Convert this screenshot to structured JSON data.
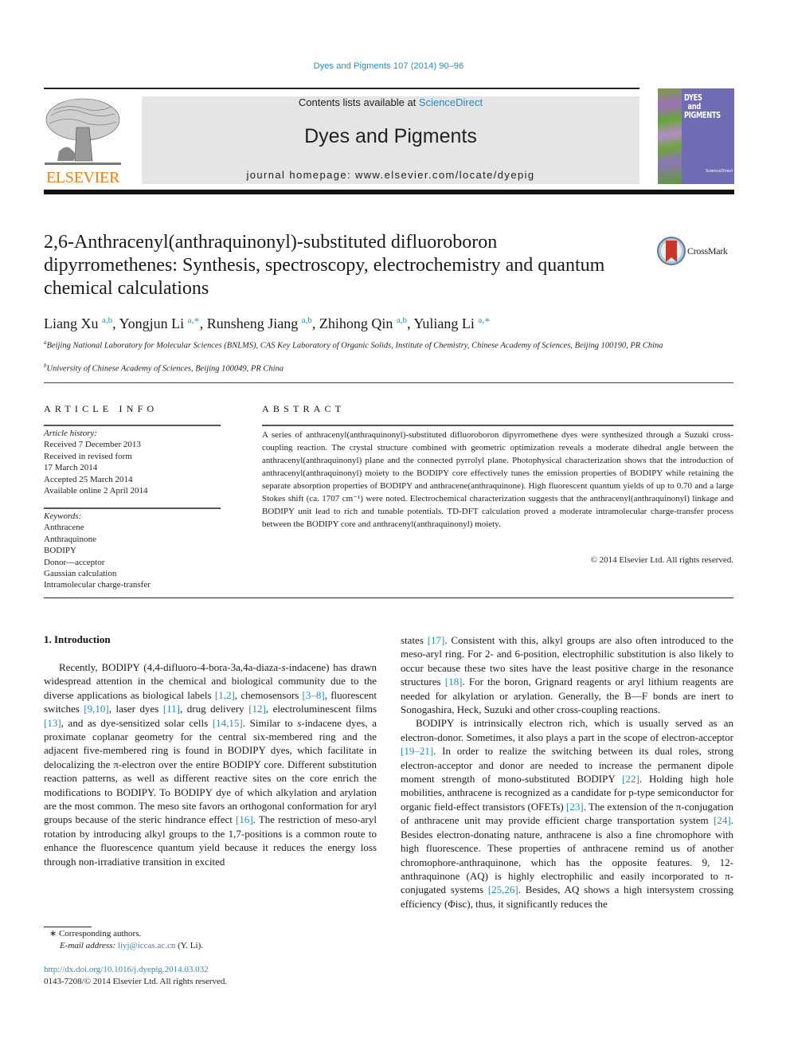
{
  "header": {
    "citation": "Dyes and Pigments 107 (2014) 90–96",
    "contents_prefix": "Contents lists available at ",
    "contents_link": "ScienceDirect",
    "journal_name": "Dyes and Pigments",
    "homepage": "journal homepage: www.elsevier.com/locate/dyepig",
    "publisher_logo_text": "ELSEVIER",
    "cover": {
      "title_line1": "DYES",
      "title_line2": "and",
      "title_line3": "PIGMENTS",
      "publisher_mark": "ScienceDirect"
    },
    "colors": {
      "link": "#2a8ab8",
      "elsevier_orange": "#f07f1b",
      "cover_purple": "#6f6cb3",
      "box_gray": "#e5e5e5"
    }
  },
  "article": {
    "title": "2,6-Anthracenyl(anthraquinonyl)-substituted difluoroboron dipyrromethenes: Synthesis, spectroscopy, electrochemistry and quantum chemical calculations",
    "crossmark_label": "CrossMark",
    "authors": [
      {
        "name": "Liang Xu",
        "sup": "a,b"
      },
      {
        "name": "Yongjun Li",
        "sup": "a,∗"
      },
      {
        "name": "Runsheng Jiang",
        "sup": "a,b"
      },
      {
        "name": "Zhihong Qin",
        "sup": "a,b"
      },
      {
        "name": "Yuliang Li",
        "sup": "a,∗"
      }
    ],
    "affiliations": [
      {
        "mark": "a",
        "text": "Beijing National Laboratory for Molecular Sciences (BNLMS), CAS Key Laboratory of Organic Solids, Institute of Chemistry, Chinese Academy of Sciences, Beijing 100190, PR China"
      },
      {
        "mark": "b",
        "text": "University of Chinese Academy of Sciences, Beijing 100049, PR China"
      }
    ]
  },
  "article_info": {
    "heading": "ARTICLE INFO",
    "history_label": "Article history:",
    "history": [
      "Received 7 December 2013",
      "Received in revised form",
      "17 March 2014",
      "Accepted 25 March 2014",
      "Available online 2 April 2014"
    ],
    "keywords_label": "Keywords:",
    "keywords": [
      "Anthracene",
      "Anthraquinone",
      "BODIPY",
      "Donor—acceptor",
      "Gaussian calculation",
      "Intramolecular charge-transfer"
    ]
  },
  "abstract": {
    "heading": "ABSTRACT",
    "text": "A series of anthracenyl(anthraquinonyl)-substituted difluoroboron dipyrromethene dyes were synthesized through a Suzuki cross-coupling reaction. The crystal structure combined with geometric optimization reveals a moderate dihedral angle between the anthracenyl(anthraquinonyl) plane and the connected pyrrolyl plane. Photophysical characterization shows that the introduction of anthracenyl(anthraquinonyl) moiety to the BODIPY core effectively tunes the emission properties of BODIPY while retaining the separate absorption properties of BODIPY and anthracene(anthraquinone). High fluorescent quantum yields of up to 0.70 and a large Stokes shift (ca. 1707 cm⁻¹) were noted. Electrochemical characterization suggests that the anthracenyl(anthraquinonyl) linkage and BODIPY unit lead to rich and tunable potentials. TD-DFT calculation proved a moderate intramolecular charge-transfer process between the BODIPY core and anthracenyl(anthraquinonyl) moiety.",
    "copyright": "© 2014 Elsevier Ltd. All rights reserved."
  },
  "body": {
    "section_heading": "1.  Introduction",
    "col1": [
      {
        "t": "Recently, BODIPY (4,4-difluoro-4-bora-3a,4a-diaza-"
      },
      {
        "i": "s"
      },
      {
        "t": "-indacene) has drawn widespread attention in the chemical and biological community due to the diverse applications as biological labels "
      },
      {
        "r": "[1,2]"
      },
      {
        "t": ", chemosensors "
      },
      {
        "r": "[3–8]"
      },
      {
        "t": ", fluorescent switches "
      },
      {
        "r": "[9,10]"
      },
      {
        "t": ", laser dyes "
      },
      {
        "r": "[11]"
      },
      {
        "t": ", drug delivery "
      },
      {
        "r": "[12]"
      },
      {
        "t": ", electroluminescent films "
      },
      {
        "r": "[13]"
      },
      {
        "t": ", and as dye-sensitized solar cells "
      },
      {
        "r": "[14,15]"
      },
      {
        "t": ". Similar to "
      },
      {
        "i": "s"
      },
      {
        "t": "-indacene dyes, a proximate coplanar geometry for the central six-membered ring and the adjacent five-membered ring is found in BODIPY dyes, which facilitate in delocalizing the π-electron over the entire BODIPY core. Different substitution reaction patterns, as well as different reactive sites on the core enrich the modifications to BODIPY. To BODIPY dye of which alkylation and arylation are the most common. The meso site favors an orthogonal conformation for aryl groups because of the steric hindrance effect "
      },
      {
        "r": "[16]"
      },
      {
        "t": ". The restriction of meso-aryl rotation by introducing alkyl groups to the 1,7-positions is a common route to enhance the fluorescence quantum yield because it reduces the energy loss through non-irradiative transition in excited"
      }
    ],
    "col2_p1": [
      {
        "t": "states "
      },
      {
        "r": "[17]"
      },
      {
        "t": ". Consistent with this, alkyl groups are also often introduced to the meso-aryl ring. For 2- and 6-position, electrophilic substitution is also likely to occur because these two sites have the least positive charge in the resonance structures "
      },
      {
        "r": "[18]"
      },
      {
        "t": ". For the boron, Grignard reagents or aryl lithium reagents are needed for alkylation or arylation. Generally, the B—F bonds are inert to Sonogashira, Heck, Suzuki and other cross-coupling reactions."
      }
    ],
    "col2_p2": [
      {
        "t": "BODIPY is intrinsically electron rich, which is usually served as an electron-donor. Sometimes, it also plays a part in the scope of electron-acceptor "
      },
      {
        "r": "[19–21]"
      },
      {
        "t": ". In order to realize the switching between its dual roles, strong electron-acceptor and donor are needed to increase the permanent dipole moment strength of mono-substituted BODIPY "
      },
      {
        "r": "[22]"
      },
      {
        "t": ". Holding high hole mobilities, anthracene is recognized as a candidate for p-type semiconductor for organic field-effect transistors (OFETs) "
      },
      {
        "r": "[23]"
      },
      {
        "t": ". The extension of the π-conjugation of anthracene unit may provide efficient charge transportation system "
      },
      {
        "r": "[24]"
      },
      {
        "t": ". Besides electron-donating nature, anthracene is also a fine chromophore with high fluorescence. These properties of anthracene remind us of another chromophore-anthraquinone, which has the opposite features. 9, 12-anthraquinone (AQ) is highly electrophilic and easily incorporated to π-conjugated systems "
      },
      {
        "r": "[25,26]"
      },
      {
        "t": ". Besides, AQ shows a high intersystem crossing efficiency (Φisc), thus, it significantly reduces the"
      }
    ]
  },
  "footnotes": {
    "corresponding": "∗  Corresponding authors.",
    "email_label": "E-mail address: ",
    "email": "liyj@iccas.ac.cn",
    "email_suffix": " (Y. Li).",
    "doi": "http://dx.doi.org/10.1016/j.dyepig.2014.03.032",
    "issn_copyright": "0143-7208/© 2014 Elsevier Ltd. All rights reserved."
  }
}
